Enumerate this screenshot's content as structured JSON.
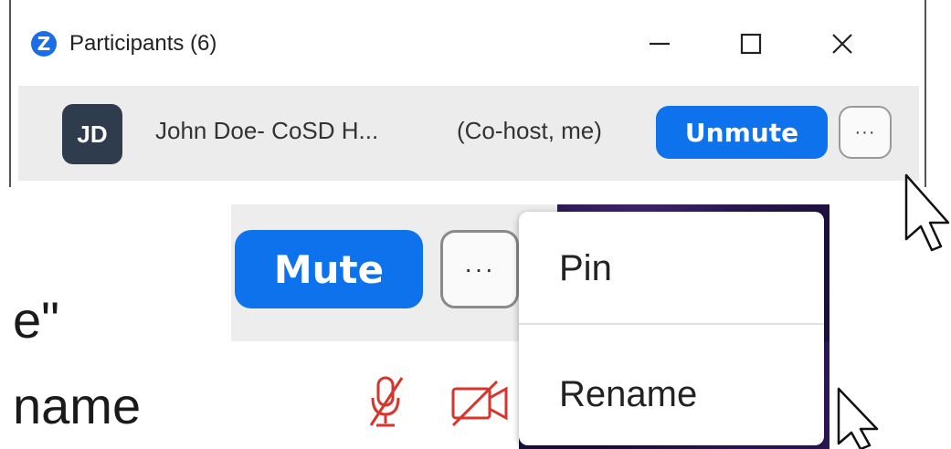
{
  "window": {
    "title": "Participants (6)",
    "logo_letter": "Z",
    "minimize_icon": "minimize-icon",
    "maximize_icon": "maximize-icon",
    "close_icon": "close-icon"
  },
  "participant": {
    "initials": "JD",
    "name": "John Doe- CoSD H...",
    "role": "(Co-host, me)",
    "unmute_label": "Unmute",
    "more_label": "···"
  },
  "controls": {
    "mute_label": "Mute",
    "more_label": "···",
    "mic_icon": "mic-muted-icon",
    "video_icon": "video-off-icon",
    "icon_color": "#d9342b"
  },
  "context_menu": {
    "items": [
      {
        "label": "Pin"
      },
      {
        "label": "Rename"
      }
    ]
  },
  "slide": {
    "fragment_1": "e\"",
    "fragment_2": "name"
  },
  "colors": {
    "accent": "#0e72ed",
    "avatar_bg": "#2e3c4d",
    "row_bg": "#ececec"
  }
}
